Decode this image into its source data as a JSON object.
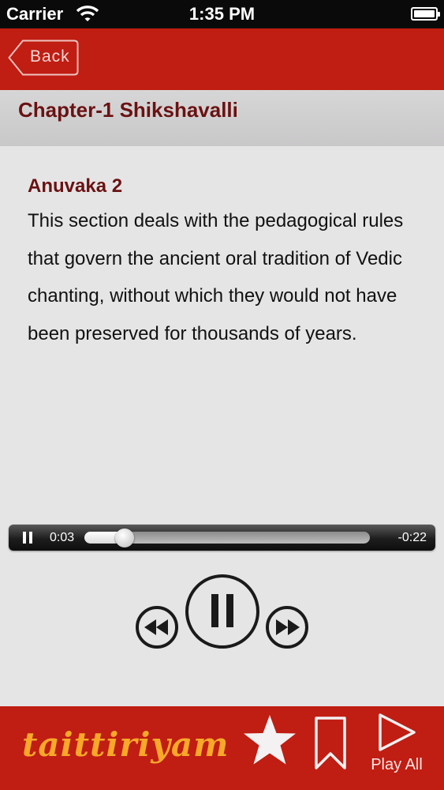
{
  "status_bar": {
    "carrier": "Carrier",
    "time": "1:35 PM"
  },
  "nav": {
    "back_label": "Back"
  },
  "chapter": {
    "title": "Chapter-1 Shikshavalli"
  },
  "section": {
    "heading": "Anuvaka 2",
    "body": "This section deals with the pedagogical rules that govern the ancient oral tradition of Vedic chanting, without which they would not have been preserved for thousands of years."
  },
  "player": {
    "elapsed": "0:03",
    "remaining": "-0:22",
    "progress": 0.12,
    "state": "playing"
  },
  "tab_bar": {
    "logo_text": "taittiriyam",
    "play_all_label": "Play All"
  },
  "icons": {
    "wifi": "wifi-icon",
    "battery": "battery-icon",
    "mini_pause": "pause-icon",
    "rewind": "rewind-icon",
    "pause": "pause-icon",
    "forward": "fast-forward-icon",
    "favorite": "star-icon",
    "bookmark": "bookmark-icon",
    "play_all": "play-icon"
  },
  "colors": {
    "accent": "#c01d13",
    "heading": "#6a1212",
    "logo": "#f7a829",
    "background": "#e6e5e6"
  }
}
